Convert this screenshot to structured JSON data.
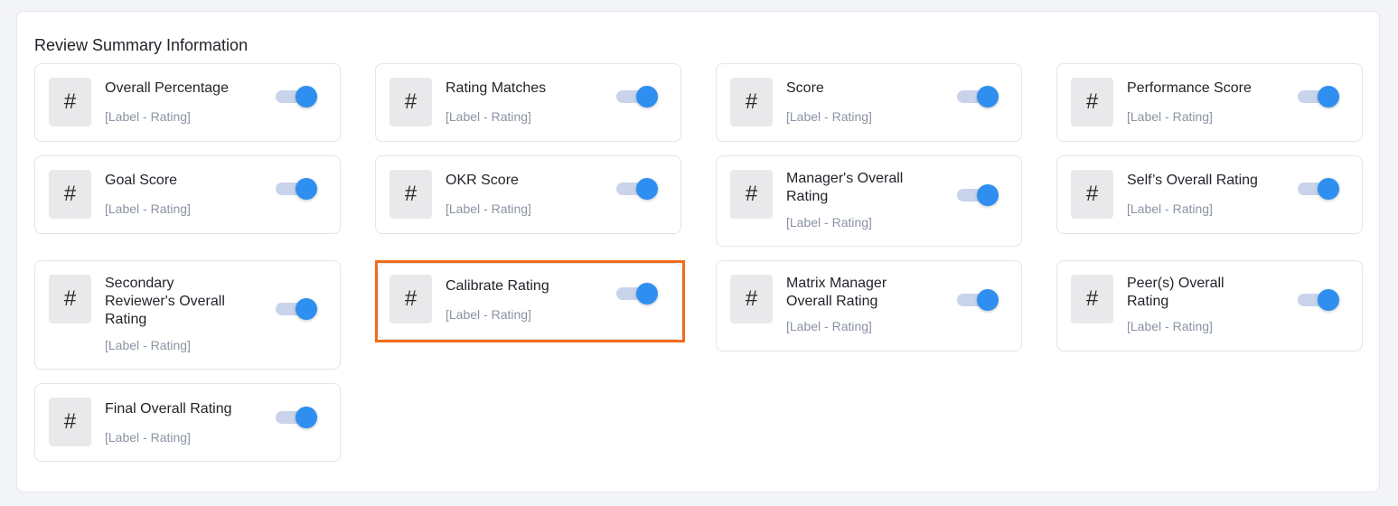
{
  "section": {
    "title": "Review Summary Information"
  },
  "placeholder_sub": "[Label - Rating]",
  "hash_symbol": "#",
  "accent_color": "#2f8ff0",
  "highlight_color": "#f26a1b",
  "cards": [
    {
      "title": "Overall Percentage",
      "sub": "[Label - Rating]",
      "enabled": true
    },
    {
      "title": "Rating Matches",
      "sub": "[Label - Rating]",
      "enabled": true
    },
    {
      "title": "Score",
      "sub": "[Label - Rating]",
      "enabled": true
    },
    {
      "title": "Performance Score",
      "sub": "[Label - Rating]",
      "enabled": true
    },
    {
      "title": "Goal Score",
      "sub": "[Label - Rating]",
      "enabled": true
    },
    {
      "title": "OKR Score",
      "sub": "[Label - Rating]",
      "enabled": true
    },
    {
      "title": "Manager's Overall Rating",
      "sub": "[Label - Rating]",
      "enabled": true
    },
    {
      "title": "Self’s Overall Rating",
      "sub": "[Label - Rating]",
      "enabled": true
    },
    {
      "title": "Secondary Reviewer's Overall Rating",
      "sub": "[Label - Rating]",
      "enabled": true
    },
    {
      "title": "Calibrate Rating",
      "sub": "[Label - Rating]",
      "enabled": true,
      "highlighted": true
    },
    {
      "title": "Matrix Manager Overall Rating",
      "sub": "[Label - Rating]",
      "enabled": true
    },
    {
      "title": "Peer(s) Overall Rating",
      "sub": "[Label - Rating]",
      "enabled": true
    },
    {
      "title": "Final Overall Rating",
      "sub": "[Label - Rating]",
      "enabled": true
    }
  ]
}
